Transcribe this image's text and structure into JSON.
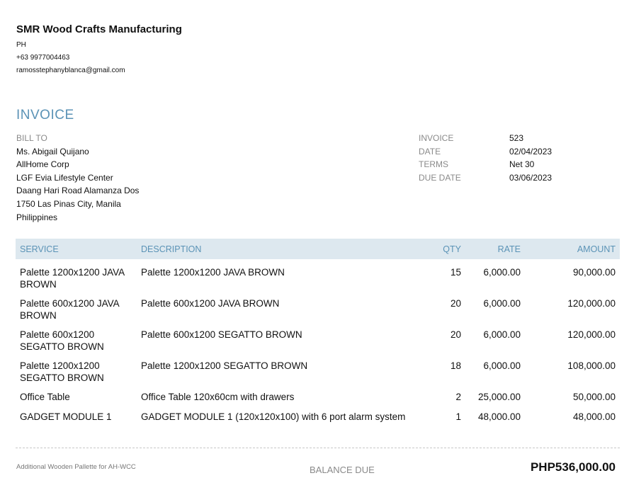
{
  "company": {
    "name": "SMR Wood Crafts Manufacturing",
    "country": "PH",
    "phone": "+63 9977004463",
    "email": "ramosstephanyblanca@gmail.com"
  },
  "invoice_title": "INVOICE",
  "bill_to": {
    "label": "BILL TO",
    "lines": [
      "Ms. Abigail Quijano",
      "AllHome Corp",
      "LGF Evia Lifestyle Center",
      "Daang Hari Road Alamanza Dos",
      "1750 Las Pinas City, Manila",
      "Philippines"
    ]
  },
  "meta": [
    {
      "label": "INVOICE",
      "value": "523"
    },
    {
      "label": "DATE",
      "value": "02/04/2023"
    },
    {
      "label": "TERMS",
      "value": "Net 30"
    },
    {
      "label": "DUE DATE",
      "value": "03/06/2023"
    }
  ],
  "table": {
    "headers": {
      "service": "SERVICE",
      "description": "DESCRIPTION",
      "qty": "QTY",
      "rate": "RATE",
      "amount": "AMOUNT"
    },
    "rows": [
      {
        "service": "Palette 1200x1200 JAVA BROWN",
        "description": "Palette 1200x1200 JAVA BROWN",
        "qty": "15",
        "rate": "6,000.00",
        "amount": "90,000.00"
      },
      {
        "service": "Palette 600x1200 JAVA BROWN",
        "description": "Palette 600x1200 JAVA BROWN",
        "qty": "20",
        "rate": "6,000.00",
        "amount": "120,000.00"
      },
      {
        "service": "Palette 600x1200 SEGATTO BROWN",
        "description": "Palette 600x1200 SEGATTO BROWN",
        "qty": "20",
        "rate": "6,000.00",
        "amount": "120,000.00"
      },
      {
        "service": "Palette 1200x1200 SEGATTO BROWN",
        "description": "Palette 1200x1200 SEGATTO BROWN",
        "qty": "18",
        "rate": "6,000.00",
        "amount": "108,000.00"
      },
      {
        "service": "Office Table",
        "description": "Office Table 120x60cm with drawers",
        "qty": "2",
        "rate": "25,000.00",
        "amount": "50,000.00"
      },
      {
        "service": "GADGET MODULE 1",
        "description": "GADGET MODULE 1 (120x120x100) with 6 port alarm system",
        "qty": "1",
        "rate": "48,000.00",
        "amount": "48,000.00"
      }
    ]
  },
  "footer": {
    "note": "Additional Wooden Pallette for AH-WCC",
    "balance_label": "BALANCE DUE",
    "balance_value": "PHP536,000.00"
  }
}
